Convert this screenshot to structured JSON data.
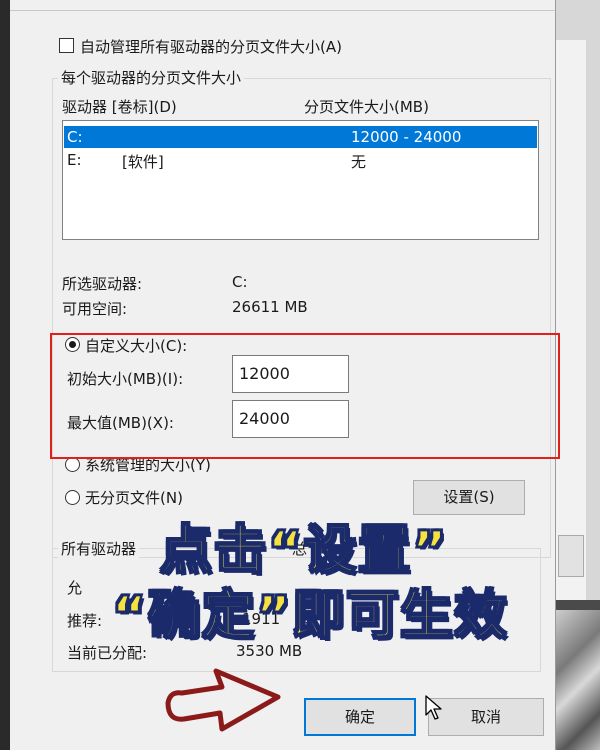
{
  "auto_manage": {
    "label": "自动管理所有驱动器的分页文件大小(A)",
    "checked": false
  },
  "per_drive": {
    "legend": "每个驱动器的分页文件大小",
    "columns": [
      "驱动器 [卷标](D)",
      "分页文件大小(MB)"
    ],
    "drives": [
      {
        "drive": "C:",
        "label": "",
        "size": "12000 - 24000",
        "selected": true
      },
      {
        "drive": "E:",
        "label": "[软件]",
        "size": "无",
        "selected": false
      }
    ],
    "selected_drive_label": "所选驱动器:",
    "selected_drive_value": "C:",
    "free_space_label": "可用空间:",
    "free_space_value": "26611 MB",
    "custom_size": {
      "label": "自定义大小(C):",
      "checked": true
    },
    "initial_size": {
      "label": "初始大小(MB)(I):",
      "value": "12000"
    },
    "max_size": {
      "label": "最大值(MB)(X):",
      "value": "24000"
    },
    "system_managed": {
      "label": "系统管理的大小(Y)",
      "checked": false
    },
    "no_paging": {
      "label": "无分页文件(N)",
      "checked": false
    },
    "set_button": "设置(S)"
  },
  "totals": {
    "legend": "所有驱动器",
    "legend_tail": "总",
    "allowed_label": "允",
    "recommended_label": "推荐:",
    "recommended_value": "1911",
    "allocated_label": "当前已分配:",
    "allocated_value": "3530 MB"
  },
  "buttons": {
    "ok": "确定",
    "cancel": "取消"
  },
  "overlay": {
    "line1": "点击“设置”",
    "line2": "“确定”即可生效",
    "colors": {
      "fill": "#f6e23e",
      "outline": "#1b2a6b",
      "highlight_box": "#e0201a",
      "arrow": "#8b1a1a"
    }
  }
}
